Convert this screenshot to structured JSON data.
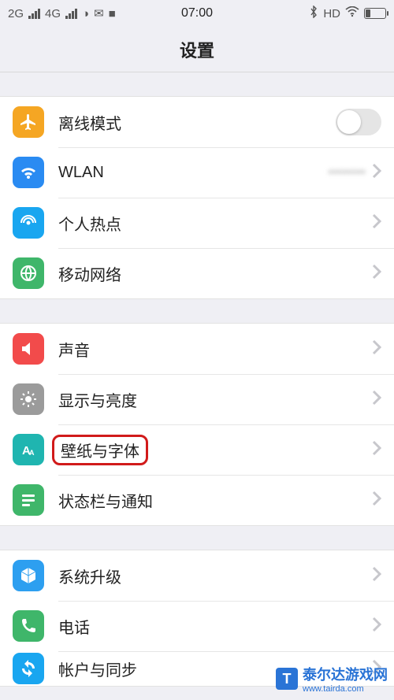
{
  "status": {
    "left_net1": "2G",
    "left_net2": "4G",
    "time": "07:00",
    "hd": "HD"
  },
  "header": {
    "title": "设置"
  },
  "groups": [
    {
      "rows": [
        {
          "key": "airplane",
          "label": "离线模式",
          "icon_color": "#f5a623",
          "control": "toggle"
        },
        {
          "key": "wlan",
          "label": "WLAN",
          "icon_color": "#2a8bf2",
          "control": "chevron",
          "detail": "••••••••"
        },
        {
          "key": "hotspot",
          "label": "个人热点",
          "icon_color": "#19a6f0",
          "control": "chevron"
        },
        {
          "key": "cellular",
          "label": "移动网络",
          "icon_color": "#3fb66a",
          "control": "chevron"
        }
      ]
    },
    {
      "rows": [
        {
          "key": "sound",
          "label": "声音",
          "icon_color": "#f24b4b",
          "control": "chevron"
        },
        {
          "key": "display",
          "label": "显示与亮度",
          "icon_color": "#9b9b9b",
          "control": "chevron"
        },
        {
          "key": "wallpaper",
          "label": "壁纸与字体",
          "icon_color": "#1fb5b0",
          "control": "chevron",
          "highlighted": true
        },
        {
          "key": "statusbar",
          "label": "状态栏与通知",
          "icon_color": "#3fb66a",
          "control": "chevron"
        }
      ]
    },
    {
      "rows": [
        {
          "key": "update",
          "label": "系统升级",
          "icon_color": "#2d9ff0",
          "control": "chevron"
        },
        {
          "key": "phone",
          "label": "电话",
          "icon_color": "#3fb66a",
          "control": "chevron"
        },
        {
          "key": "account",
          "label": "帐户与同步",
          "icon_color": "#19a6f0",
          "control": "chevron",
          "partial": true
        }
      ]
    }
  ],
  "watermark": {
    "text": "泰尔达游戏网",
    "url": "www.tairda.com"
  }
}
